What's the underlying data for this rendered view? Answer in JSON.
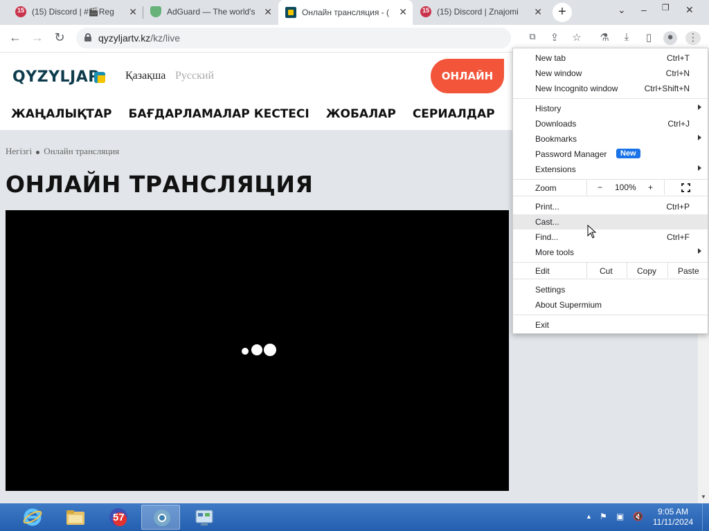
{
  "browser": {
    "tabs": [
      {
        "title": "(15) Discord | #🎬Reg",
        "icon": "discord-icon",
        "active": false
      },
      {
        "title": "AdGuard — The world's",
        "icon": "adguard-shield-icon",
        "active": false
      },
      {
        "title": "Онлайн трансляция - (",
        "icon": "qyzyljar-icon",
        "active": true
      },
      {
        "title": "(15) Discord | Znajomi",
        "icon": "discord-icon",
        "active": false
      }
    ],
    "discord_badge": "15",
    "url_host": "qyzyljartv.kz",
    "url_path": "/kz/live"
  },
  "site": {
    "logo": "QYZYLJAR",
    "lang_kz": "Қазақша",
    "lang_ru": "Русский",
    "online_button": "ОНЛАЙН",
    "nav": [
      "ЖАҢАЛЫҚТАР",
      "БАҒДАРЛАМАЛАР КЕСТЕСІ",
      "ЖОБАЛАР",
      "СЕРИАЛДАР"
    ],
    "breadcrumb": {
      "home": "Негізгі",
      "current": "Онлайн трансляция"
    },
    "page_title": "ОНЛАЙН ТРАНСЛЯЦИЯ"
  },
  "menu": {
    "new_tab": {
      "label": "New tab",
      "shortcut": "Ctrl+T"
    },
    "new_window": {
      "label": "New window",
      "shortcut": "Ctrl+N"
    },
    "new_incognito": {
      "label": "New Incognito window",
      "shortcut": "Ctrl+Shift+N"
    },
    "history": {
      "label": "History"
    },
    "downloads": {
      "label": "Downloads",
      "shortcut": "Ctrl+J"
    },
    "bookmarks": {
      "label": "Bookmarks"
    },
    "password_manager": {
      "label": "Password Manager",
      "badge": "New"
    },
    "extensions": {
      "label": "Extensions"
    },
    "zoom": {
      "label": "Zoom",
      "minus": "−",
      "value": "100%",
      "plus": "+"
    },
    "print": {
      "label": "Print...",
      "shortcut": "Ctrl+P"
    },
    "cast": {
      "label": "Cast..."
    },
    "find": {
      "label": "Find...",
      "shortcut": "Ctrl+F"
    },
    "more_tools": {
      "label": "More tools"
    },
    "edit": {
      "label": "Edit",
      "cut": "Cut",
      "copy": "Copy",
      "paste": "Paste"
    },
    "settings": {
      "label": "Settings"
    },
    "about": {
      "label": "About Supermium"
    },
    "exit": {
      "label": "Exit"
    }
  },
  "taskbar": {
    "badge_count": "57",
    "time": "9:05 AM",
    "date": "11/11/2024"
  },
  "colors": {
    "accent_online": "#f2553a",
    "menu_highlight": "#e8e8e9",
    "badge_new": "#1a73e8",
    "taskbar": "#2d6abf"
  }
}
